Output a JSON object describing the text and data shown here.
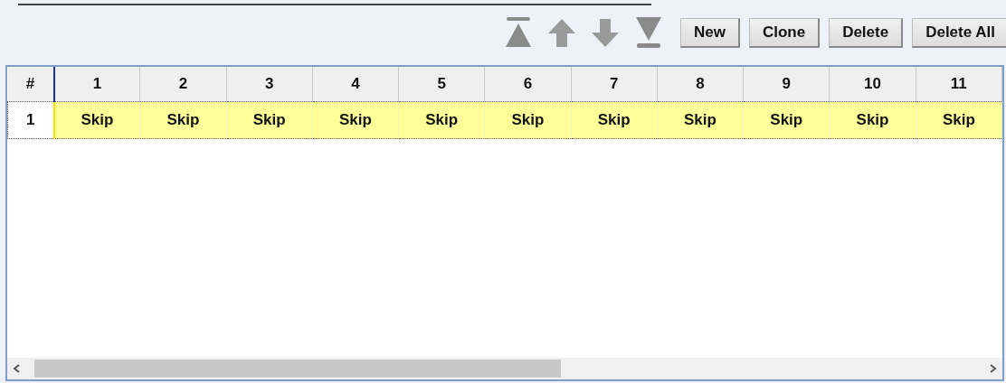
{
  "toolbar": {
    "buttons": [
      "New",
      "Clone",
      "Delete",
      "Delete All"
    ]
  },
  "table": {
    "corner": "#",
    "columns": [
      "1",
      "2",
      "3",
      "4",
      "5",
      "6",
      "7",
      "8",
      "9",
      "10",
      "11"
    ],
    "rows": [
      {
        "number": "1",
        "selected": true,
        "cells": [
          "Skip",
          "Skip",
          "Skip",
          "Skip",
          "Skip",
          "Skip",
          "Skip",
          "Skip",
          "Skip",
          "Skip",
          "Skip"
        ]
      }
    ]
  }
}
